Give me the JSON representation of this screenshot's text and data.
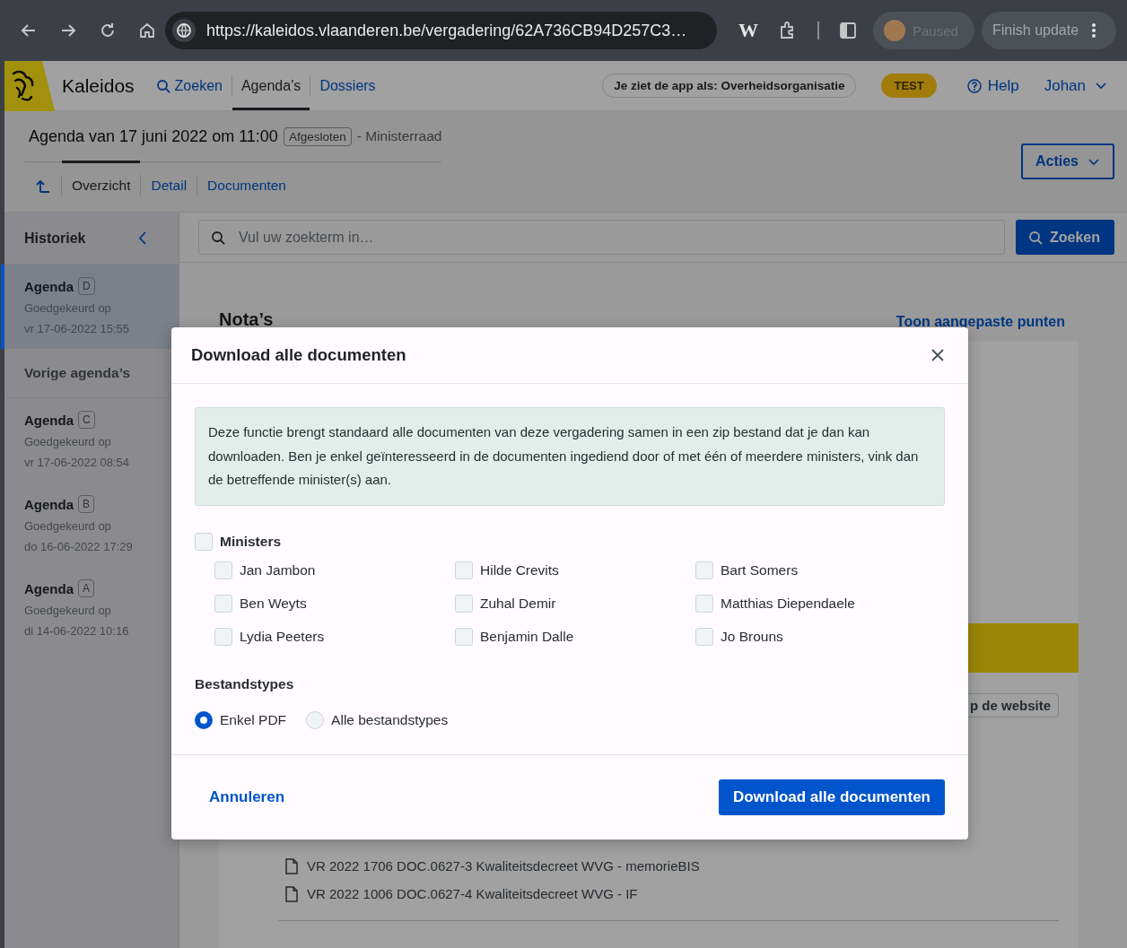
{
  "browser": {
    "url": "https://kaleidos.vlaanderen.be/vergadering/62A736CB94D257C3…",
    "extension_label": "W",
    "profile_status": "Paused",
    "update_button": "Finish update"
  },
  "app_header": {
    "app_name": "Kaleidos",
    "nav": [
      {
        "kind": "search",
        "label": "Zoeken",
        "selected": false
      },
      {
        "kind": "page",
        "label": "Agenda’s",
        "selected": true
      },
      {
        "kind": "page",
        "label": "Dossiers",
        "selected": false
      }
    ],
    "role": "Je ziet de app als: Overheidsorganisatie",
    "env_badge": "TEST",
    "help": "Help",
    "user": "Johan"
  },
  "agenda": {
    "title": "Agenda van 17 juni 2022 om 11:00",
    "status": "Afgesloten",
    "meeting_type": "- Ministerraad",
    "tabs": [
      {
        "label": "Overzicht",
        "selected": true
      },
      {
        "label": "Detail",
        "selected": false
      },
      {
        "label": "Documenten",
        "selected": false
      }
    ],
    "actions": "Acties"
  },
  "sidebar": {
    "title": "Historiek",
    "items": [
      {
        "kind": "agenda",
        "label": "Agenda",
        "version": "D",
        "status": "Goedgekeurd op",
        "date": "vr 17-06-2022 15:55",
        "selected": true
      },
      {
        "kind": "heading",
        "label": "Vorige agenda’s"
      },
      {
        "kind": "agenda",
        "label": "Agenda",
        "version": "C",
        "status": "Goedgekeurd op",
        "date": "vr 17-06-2022 08:54",
        "selected": false
      },
      {
        "kind": "agenda",
        "label": "Agenda",
        "version": "B",
        "status": "Goedgekeurd op",
        "date": "do 16-06-2022 17:29",
        "selected": false
      },
      {
        "kind": "agenda",
        "label": "Agenda",
        "version": "A",
        "status": "Goedgekeurd op",
        "date": "di 14-06-2022 10:16",
        "selected": false
      }
    ]
  },
  "search": {
    "placeholder": "Vul uw zoekterm in…",
    "button": "Zoeken"
  },
  "content": {
    "heading": "Nota’s",
    "link": "Toon aangepaste punten",
    "chip": "p de website",
    "documents": [
      "VR 2022 1706 DOC.0627-3 Kwaliteitsdecreet WVG - memorieBIS",
      "VR 2022 1006 DOC.0627-4 Kwaliteitsdecreet WVG - IF"
    ]
  },
  "modal": {
    "title": "Download alle documenten",
    "info": "Deze functie brengt standaard alle documenten van deze vergadering samen in een zip bestand dat je dan kan downloaden. Ben je enkel geïnteresseerd in de documenten ingediend door of met één of meerdere ministers, vink dan de betreffende minister(s) aan.",
    "ministers_label": "Ministers",
    "ministers_checked": false,
    "ministers": [
      {
        "name": "Jan Jambon",
        "checked": false
      },
      {
        "name": "Hilde Crevits",
        "checked": false
      },
      {
        "name": "Bart Somers",
        "checked": false
      },
      {
        "name": "Ben Weyts",
        "checked": false
      },
      {
        "name": "Zuhal Demir",
        "checked": false
      },
      {
        "name": "Matthias Diependaele",
        "checked": false
      },
      {
        "name": "Lydia Peeters",
        "checked": false
      },
      {
        "name": "Benjamin Dalle",
        "checked": false
      },
      {
        "name": "Jo Brouns",
        "checked": false
      }
    ],
    "filetypes_label": "Bestandstypes",
    "filetypes": [
      {
        "label": "Enkel PDF",
        "selected": true
      },
      {
        "label": "Alle bestandstypes",
        "selected": false
      }
    ],
    "cancel": "Annuleren",
    "submit": "Download alle documenten"
  }
}
